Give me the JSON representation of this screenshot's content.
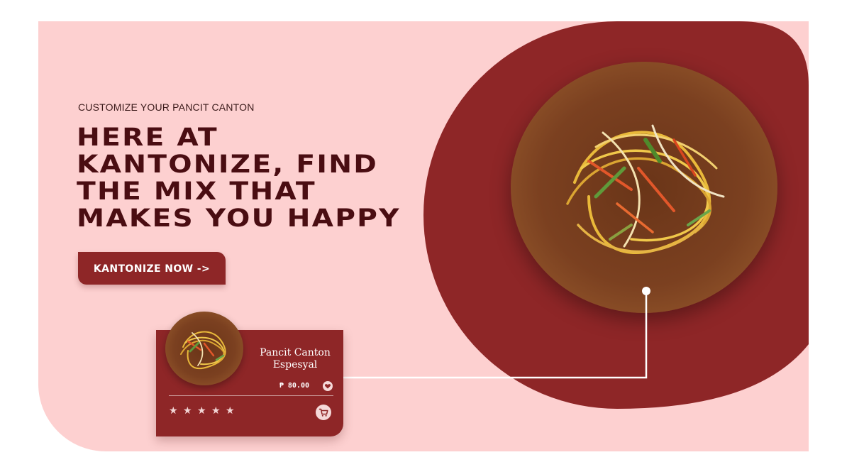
{
  "hero": {
    "eyebrow": "CUSTOMIZE YOUR PANCIT CANTON",
    "headline_lines": [
      "HERE AT",
      "KANTONIZE, FIND",
      "THE MIX THAT",
      "MAKES YOU HAPPY"
    ],
    "cta_label": "KANTONIZE NOW ->"
  },
  "product_card": {
    "name_line1": "Pancit Canton",
    "name_line2": "Espesyal",
    "price": "₱ 80.00",
    "rating": 5,
    "favorite_icon": "heart-icon",
    "cart_icon": "cart-icon",
    "stars": [
      "★",
      "★",
      "★",
      "★",
      "★"
    ]
  },
  "colors": {
    "background_pink": "#fdd0d0",
    "accent_red": "#8e2627",
    "headline": "#4a0d12"
  }
}
